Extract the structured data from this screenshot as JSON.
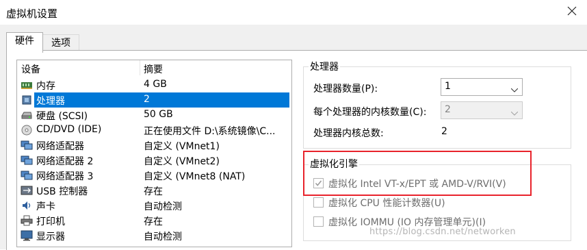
{
  "window": {
    "title": "虚拟机设置"
  },
  "tabs": [
    "硬件",
    "选项"
  ],
  "device_list": {
    "columns": [
      "设备",
      "摘要"
    ],
    "rows": [
      {
        "device": "内存",
        "summary": "4 GB",
        "icon": "memory-icon",
        "selected": false
      },
      {
        "device": "处理器",
        "summary": "2",
        "icon": "processor-icon",
        "selected": true
      },
      {
        "device": "硬盘 (SCSI)",
        "summary": "50 GB",
        "icon": "hard-disk-icon",
        "selected": false
      },
      {
        "device": "CD/DVD (IDE)",
        "summary": "正在使用文件 D:\\系统镜像\\C...",
        "icon": "cd-dvd-icon",
        "selected": false
      },
      {
        "device": "网络适配器",
        "summary": "自定义 (VMnet1)",
        "icon": "network-adapter-icon",
        "selected": false
      },
      {
        "device": "网络适配器 2",
        "summary": "自定义 (VMnet2)",
        "icon": "network-adapter-icon",
        "selected": false
      },
      {
        "device": "网络适配器 3",
        "summary": "自定义 (VMnet8 (NAT)",
        "icon": "network-adapter-icon",
        "selected": false
      },
      {
        "device": "USB 控制器",
        "summary": "存在",
        "icon": "usb-icon",
        "selected": false
      },
      {
        "device": "声卡",
        "summary": "自动检测",
        "icon": "sound-card-icon",
        "selected": false
      },
      {
        "device": "打印机",
        "summary": "存在",
        "icon": "printer-icon",
        "selected": false
      },
      {
        "device": "显示器",
        "summary": "自动检测",
        "icon": "display-icon",
        "selected": false
      }
    ]
  },
  "processor": {
    "group_label": "处理器",
    "count_label": "处理器数量(P):",
    "count_value": "1",
    "cores_label": "每个处理器的内核数量(C):",
    "cores_value": "2",
    "total_label": "处理器内核总数:",
    "total_value": "2"
  },
  "virtualization": {
    "group_label": "虚拟化引擎",
    "options": [
      {
        "label": "虚拟化 Intel VT-x/EPT 或 AMD-V/RVI(V)",
        "checked": true
      },
      {
        "label": "虚拟化 CPU 性能计数器(U)",
        "checked": false
      },
      {
        "label": "虚拟化 IOMMU (IO 内存管理单元)(I)",
        "checked": false
      }
    ]
  },
  "watermark": "https://blog.csdn.net/networken",
  "colors": {
    "selection": "#0078d7",
    "highlight_box": "#e8222b"
  }
}
